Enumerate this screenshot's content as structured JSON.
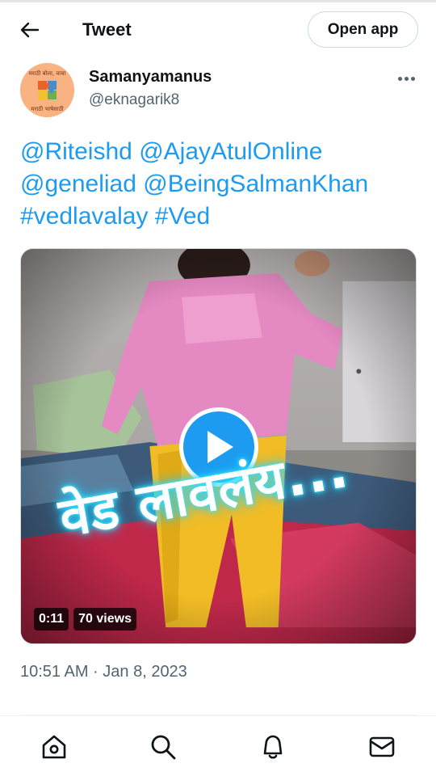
{
  "header": {
    "title": "Tweet",
    "open_app_label": "Open app",
    "back_icon": "arrow-left-icon"
  },
  "author": {
    "name": "Samanyamanus",
    "handle": "@eknagarik8",
    "avatar_caption_top": "मराठी बोला, वाचा",
    "avatar_caption_bottom": "मराठी भाषेसाठी"
  },
  "tweet": {
    "lines": [
      [
        "@Riteishd",
        "@AjayAtulOnline"
      ],
      [
        "@geneliad",
        "@BeingSalmanKhan"
      ],
      [
        "#vedlavalay",
        "#Ved"
      ]
    ],
    "link_color": "#1d9bf0"
  },
  "media": {
    "overlay_text": "वेड लावलंय...",
    "duration": "0:11",
    "views": "70 views",
    "play_icon": "play-icon",
    "play_color": "#1d9bf0"
  },
  "timestamp": "10:51 AM · Jan 8, 2023",
  "bottom_nav": [
    {
      "name": "home",
      "icon": "home-icon"
    },
    {
      "name": "search",
      "icon": "search-icon"
    },
    {
      "name": "notifications",
      "icon": "bell-icon"
    },
    {
      "name": "messages",
      "icon": "envelope-icon"
    }
  ]
}
